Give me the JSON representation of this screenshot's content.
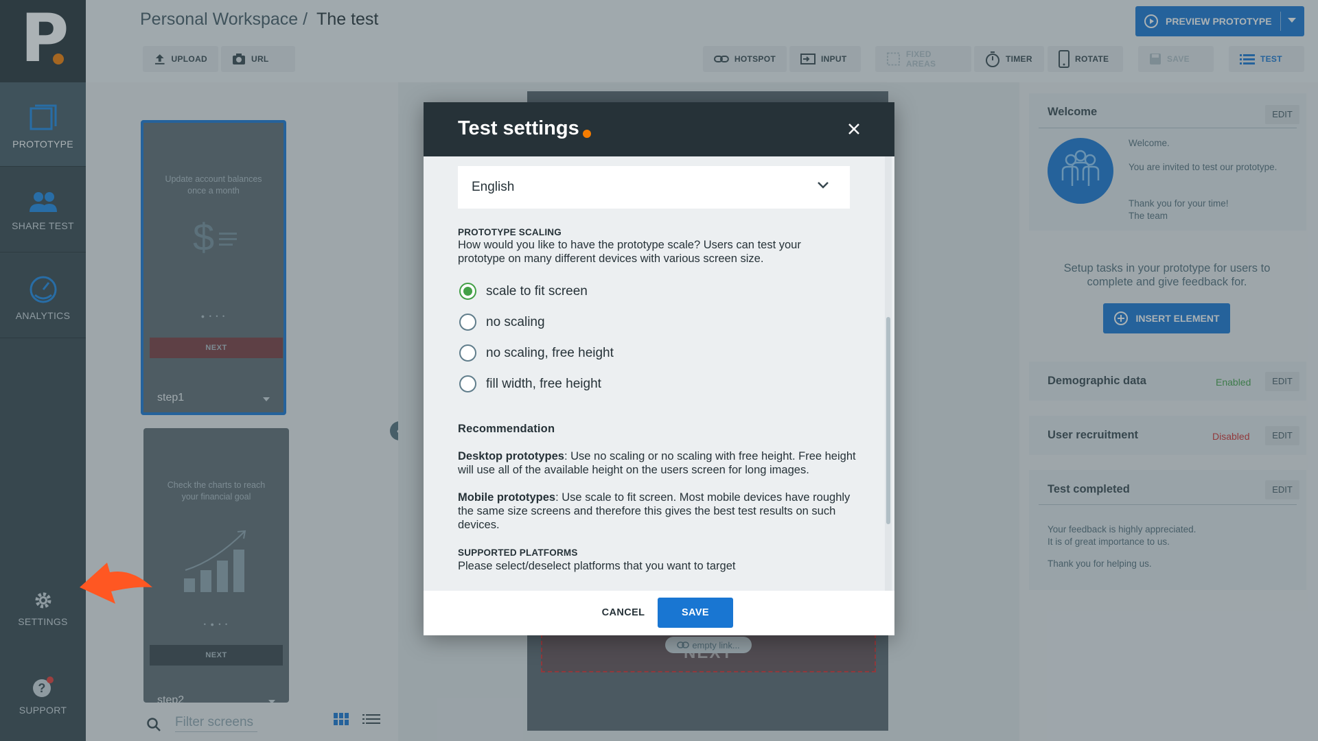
{
  "app": {
    "workspace": "Personal Workspace /",
    "test_name": "The test"
  },
  "nav": {
    "items": [
      {
        "label": "PROTOTYPE",
        "icon": "prototype-icon"
      },
      {
        "label": "SHARE TEST",
        "icon": "users-icon"
      },
      {
        "label": "ANALYTICS",
        "icon": "gauge-icon"
      },
      {
        "label": "SETTINGS",
        "icon": "gear-icon"
      },
      {
        "label": "SUPPORT",
        "icon": "help-icon"
      }
    ]
  },
  "toolbar": {
    "upload": "UPLOAD",
    "url": "URL",
    "hotspot": "HOTSPOT",
    "input": "INPUT",
    "fixed_areas": "FIXED AREAS",
    "timer": "TIMER",
    "rotate": "ROTATE",
    "save": "SAVE",
    "test": "TEST",
    "preview": "PREVIEW PROTOTYPE"
  },
  "screens": [
    {
      "text": "Update account balances once a month",
      "next": "NEXT",
      "name": "step1"
    },
    {
      "text": "Check the charts to reach your financial goal",
      "next": "NEXT",
      "name": "step2"
    }
  ],
  "filter": {
    "placeholder": "Filter screens"
  },
  "canvas": {
    "empty_link": "empty link...",
    "next": "NEXT"
  },
  "right": {
    "welcome": {
      "title": "Welcome",
      "edit": "EDIT",
      "line1": "Welcome.",
      "line2": "You are invited to test our prototype.",
      "line3": "Thank you for your time!",
      "line4": "The team"
    },
    "setup_text": "Setup tasks in your prototype for users to complete and give feedback for.",
    "insert_element": "INSERT ELEMENT",
    "demographic": {
      "title": "Demographic data",
      "status": "Enabled",
      "edit": "EDIT"
    },
    "recruitment": {
      "title": "User recruitment",
      "status": "Disabled",
      "edit": "EDIT"
    },
    "completed": {
      "title": "Test completed",
      "edit": "EDIT",
      "line1": "Your feedback is highly appreciated.",
      "line2": "It is of great importance to us.",
      "line3": "Thank you for helping us."
    }
  },
  "modal": {
    "title": "Test settings",
    "language": "English",
    "scaling_heading": "PROTOTYPE SCALING",
    "scaling_desc": "How would you like to have the prototype scale? Users can test your prototype on many different devices with various screen size.",
    "options": [
      {
        "label": "scale to fit screen",
        "checked": true
      },
      {
        "label": "no scaling",
        "checked": false
      },
      {
        "label": "no scaling, free height",
        "checked": false
      },
      {
        "label": "fill width, free height",
        "checked": false
      }
    ],
    "recommendation_heading": "Recommendation",
    "desktop_label": "Desktop prototypes",
    "desktop_text": ": Use no scaling or no scaling with free height. Free height will use all of the available height on the users screen for long images.",
    "mobile_label": "Mobile prototypes",
    "mobile_text": ": Use scale to fit screen. Most mobile devices have roughly the same size screens and therefore this gives the best test results on such devices.",
    "platforms_heading": "SUPPORTED PLATFORMS",
    "platforms_desc": "Please select/deselect platforms that you want to target",
    "cancel": "CANCEL",
    "save": "SAVE"
  },
  "colors": {
    "accent": "#1976d2",
    "brand_orange": "#f57c00",
    "enabled": "#43a047",
    "disabled": "#d32f2f",
    "nav_bg": "#37474f",
    "modal_header": "#263238"
  }
}
